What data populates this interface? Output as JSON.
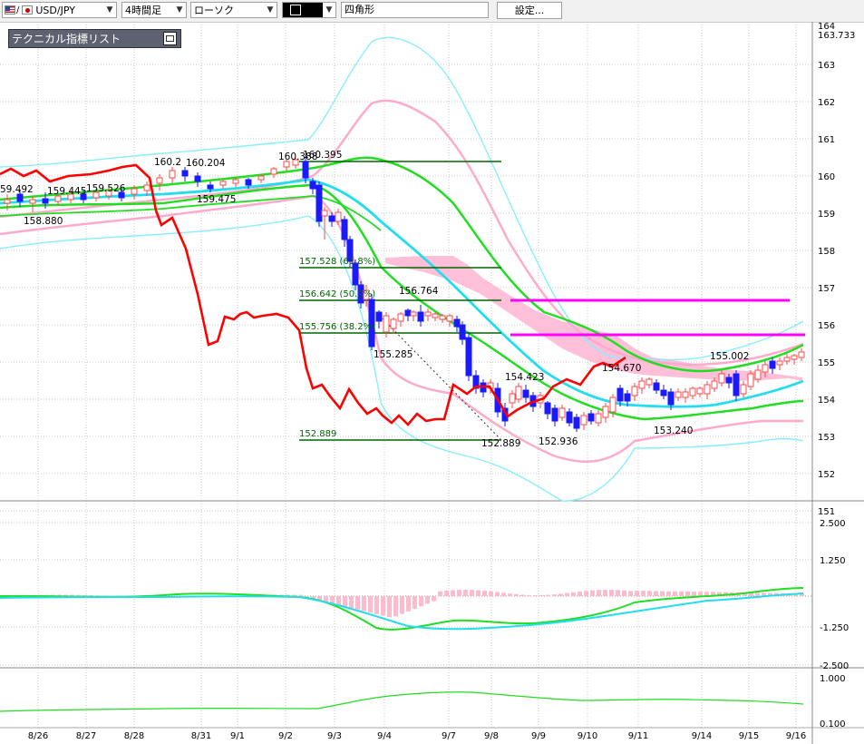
{
  "toolbar": {
    "pair": {
      "slash": "/",
      "symbol": "USD/JPY"
    },
    "timeframe": "4時間足",
    "chart_style": "ローソク",
    "drawing_color_label": "□",
    "shape": "四角形",
    "settings_label": "設定..."
  },
  "panel": {
    "title": "テクニカル指標リスト"
  },
  "price_axis": {
    "labels": [
      "164",
      "163.733",
      "163",
      "162",
      "161",
      "160",
      "159",
      "158",
      "157",
      "156",
      "155",
      "154",
      "153",
      "152",
      "151"
    ]
  },
  "macd_axis": {
    "labels": [
      "2.500",
      "1.250",
      "-1.250",
      "-2.500"
    ]
  },
  "rsi_axis": {
    "labels": [
      "1.000",
      "0.100"
    ]
  },
  "date_axis": {
    "labels": [
      "8/26",
      "8/27",
      "8/28",
      "8/31",
      "9/1",
      "9/2",
      "9/3",
      "9/4",
      "9/7",
      "9/8",
      "9/9",
      "9/10",
      "9/11",
      "9/14",
      "9/15",
      "9/16"
    ]
  },
  "annotations": {
    "high_low": [
      "59.492",
      "159.445",
      "159.526",
      "158.880",
      "160.2",
      "160.204",
      "159.475",
      "160.388",
      "160.395",
      "156.764",
      "155.285",
      "154.423",
      "154.670",
      "152.889",
      "152.936",
      "153.240",
      "155.002"
    ],
    "fibo": [
      "157.528 (61.8%)",
      "156.642 (50.0%)",
      "155.756 (38.2%)",
      "152.889"
    ]
  },
  "colors": {
    "up_candle": "#ff4848",
    "down_candle": "#1a1aff",
    "ichimoku_lagging": "#ff0000",
    "ma_green": "#22dd22",
    "ma_cyan": "#22ddee",
    "bollinger_pink": "#ffaacc",
    "bollinger_outer": "#88eeff",
    "cloud": "#ffbfd8",
    "horizontal_magenta": "#ff00ff",
    "fibo_lines": "#006600"
  }
}
